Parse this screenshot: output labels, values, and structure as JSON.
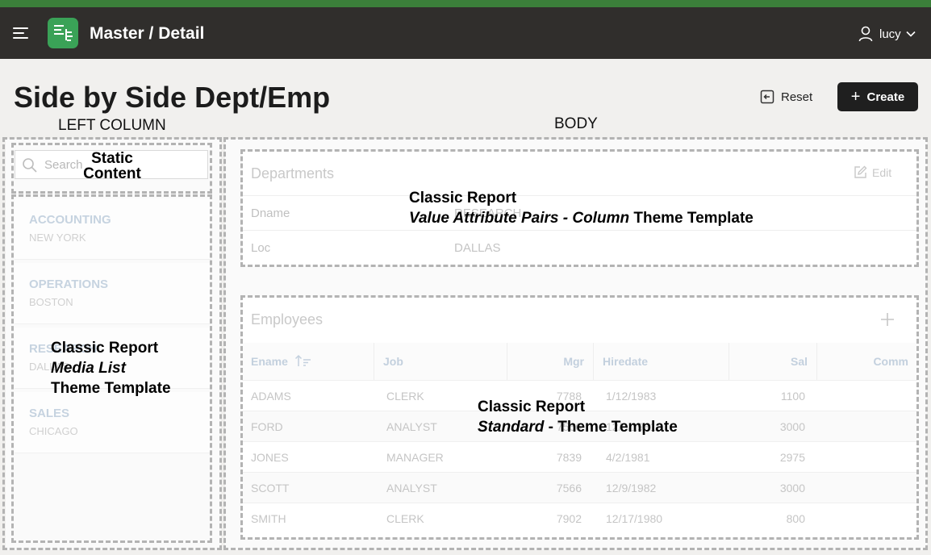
{
  "header": {
    "app_title": "Master / Detail",
    "user_name": "lucy"
  },
  "page": {
    "title": "Side by Side Dept/Emp",
    "reset_label": "Reset",
    "create_label": "Create"
  },
  "annotations": {
    "left_column": "LEFT COLUMN",
    "body": "BODY",
    "static_content_line1": "Static",
    "static_content_line2": "Content",
    "media_list_line1": "Classic Report",
    "media_list_line2": "Media List",
    "media_list_line3": "Theme Template",
    "vap_line1": "Classic Report",
    "vap_italic": "Value Attribute Pairs - Column",
    "vap_rest": " Theme Template",
    "standard_line1": "Classic Report",
    "standard_italic": "Standard",
    "standard_rest": " - Theme Template"
  },
  "search": {
    "placeholder": "Search"
  },
  "departments_list": [
    {
      "name": "ACCOUNTING",
      "location": "NEW YORK"
    },
    {
      "name": "OPERATIONS",
      "location": "BOSTON"
    },
    {
      "name": "RESEARCH",
      "location": "DALLAS"
    },
    {
      "name": "SALES",
      "location": "CHICAGO"
    }
  ],
  "department_detail": {
    "title": "Departments",
    "edit_label": "Edit",
    "rows": [
      {
        "label": "Dname",
        "value": "RESEARCH"
      },
      {
        "label": "Loc",
        "value": "DALLAS"
      }
    ]
  },
  "employees": {
    "title": "Employees",
    "columns": [
      "Ename",
      "Job",
      "Mgr",
      "Hiredate",
      "Sal",
      "Comm"
    ],
    "rows": [
      {
        "ename": "ADAMS",
        "job": "CLERK",
        "mgr": "7788",
        "hiredate": "1/12/1983",
        "sal": "1100",
        "comm": ""
      },
      {
        "ename": "FORD",
        "job": "ANALYST",
        "mgr": "7566",
        "hiredate": "12/3/1981",
        "sal": "3000",
        "comm": ""
      },
      {
        "ename": "JONES",
        "job": "MANAGER",
        "mgr": "7839",
        "hiredate": "4/2/1981",
        "sal": "2975",
        "comm": ""
      },
      {
        "ename": "SCOTT",
        "job": "ANALYST",
        "mgr": "7566",
        "hiredate": "12/9/1982",
        "sal": "3000",
        "comm": ""
      },
      {
        "ename": "SMITH",
        "job": "CLERK",
        "mgr": "7902",
        "hiredate": "12/17/1980",
        "sal": "800",
        "comm": ""
      }
    ]
  }
}
